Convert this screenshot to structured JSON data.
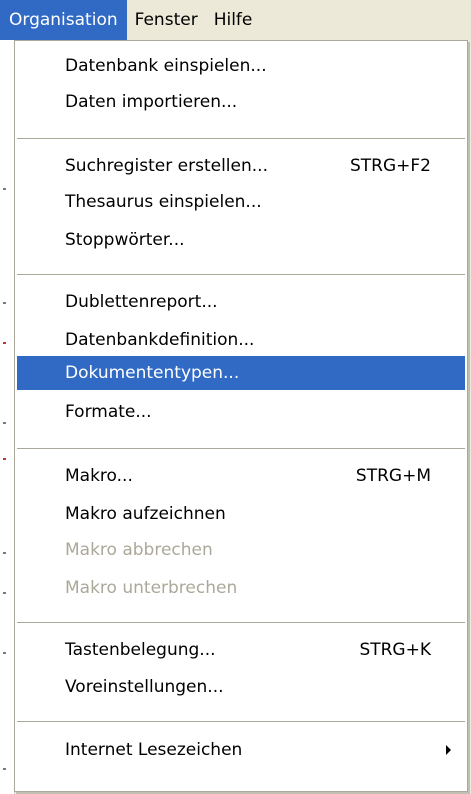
{
  "menubar": {
    "items": [
      {
        "label": "Organisation",
        "active": true
      },
      {
        "label": "Fenster",
        "active": false
      },
      {
        "label": "Hilfe",
        "active": false
      }
    ]
  },
  "menu": {
    "items": [
      {
        "label": "Datenbank einspielen...",
        "shortcut": "",
        "state": "normal"
      },
      {
        "label": "Daten importieren...",
        "shortcut": "",
        "state": "normal"
      },
      {
        "label": "Suchregister erstellen...",
        "shortcut": "STRG+F2",
        "state": "normal"
      },
      {
        "label": "Thesaurus einspielen...",
        "shortcut": "",
        "state": "normal"
      },
      {
        "label": "Stoppwörter...",
        "shortcut": "",
        "state": "normal"
      },
      {
        "label": "Dublettenreport...",
        "shortcut": "",
        "state": "normal"
      },
      {
        "label": "Datenbankdefinition...",
        "shortcut": "",
        "state": "normal"
      },
      {
        "label": "Dokumententypen...",
        "shortcut": "",
        "state": "selected"
      },
      {
        "label": "Formate...",
        "shortcut": "",
        "state": "normal"
      },
      {
        "label": "Makro...",
        "shortcut": "STRG+M",
        "state": "normal"
      },
      {
        "label": "Makro aufzeichnen",
        "shortcut": "",
        "state": "normal"
      },
      {
        "label": "Makro abbrechen",
        "shortcut": "",
        "state": "disabled"
      },
      {
        "label": "Makro unterbrechen",
        "shortcut": "",
        "state": "disabled"
      },
      {
        "label": "Tastenbelegung...",
        "shortcut": "STRG+K",
        "state": "normal"
      },
      {
        "label": "Voreinstellungen...",
        "shortcut": "",
        "state": "normal"
      },
      {
        "label": "Internet Lesezeichen",
        "shortcut": "",
        "state": "normal",
        "submenu": true
      }
    ]
  },
  "colors": {
    "highlight": "#316ac5",
    "menubar_bg": "#ece9d8",
    "menu_bg": "#ffffff",
    "disabled_text": "#aca899",
    "separator": "#aca899"
  }
}
